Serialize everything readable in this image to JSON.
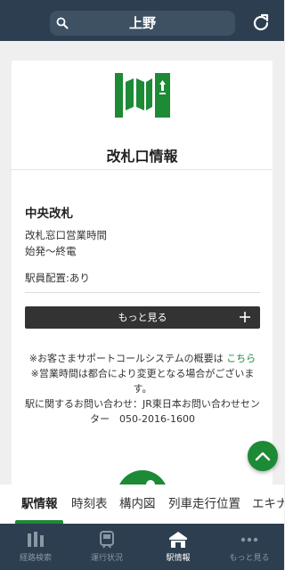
{
  "header": {
    "title": "上野"
  },
  "card": {
    "title": "改札口情報",
    "gate_name": "中央改札",
    "window_hours_label": "改札窓口営業時間",
    "window_hours_value": "始発～終電",
    "staff_label": "駅員配置:あり",
    "more_label": "もっと見る",
    "note1_text": "※お客さまサポートコールシステムの概要は ",
    "note1_link": "こちら",
    "note2": "※営業時間は都合により変更となる場合がございます。",
    "note3": "駅に関するお問い合わせ：JR東日本お問い合わせセンター　050-2016-1600"
  },
  "tabs": [
    {
      "label": "駅情報",
      "active": true
    },
    {
      "label": "時刻表"
    },
    {
      "label": "構内図"
    },
    {
      "label": "列車走行位置"
    },
    {
      "label": "エキナ"
    }
  ],
  "bottom_nav": [
    {
      "label": "経路検索",
      "icon": "route-search-icon"
    },
    {
      "label": "運行状況",
      "icon": "train-icon"
    },
    {
      "label": "駅情報",
      "icon": "station-icon",
      "active": true
    },
    {
      "label": "もっと見る",
      "icon": "more-dots-icon"
    }
  ],
  "colors": {
    "header": "#2c3e4f",
    "accent": "#1d8a36"
  }
}
